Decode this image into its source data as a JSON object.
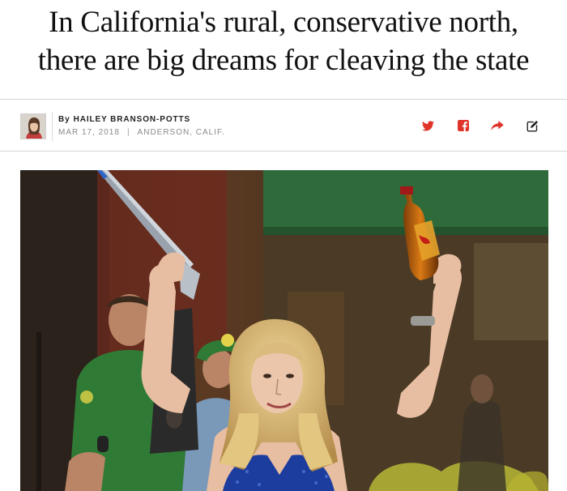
{
  "article": {
    "headline_line1": "In California's rural, conservative north,",
    "headline_line2": "there are big dreams for cleaving the state"
  },
  "byline": {
    "by": "By",
    "author": "HAILEY BRANSON-POTTS",
    "date": "MAR 17, 2018",
    "separator": "|",
    "location": "ANDERSON, CALIF."
  },
  "share": {
    "icons": [
      "twitter-icon",
      "facebook-icon",
      "share-forward-icon",
      "edit-icon"
    ],
    "accent_color": "#e0342a",
    "edit_color": "#222222"
  },
  "photo": {
    "description_icon": "photo"
  }
}
